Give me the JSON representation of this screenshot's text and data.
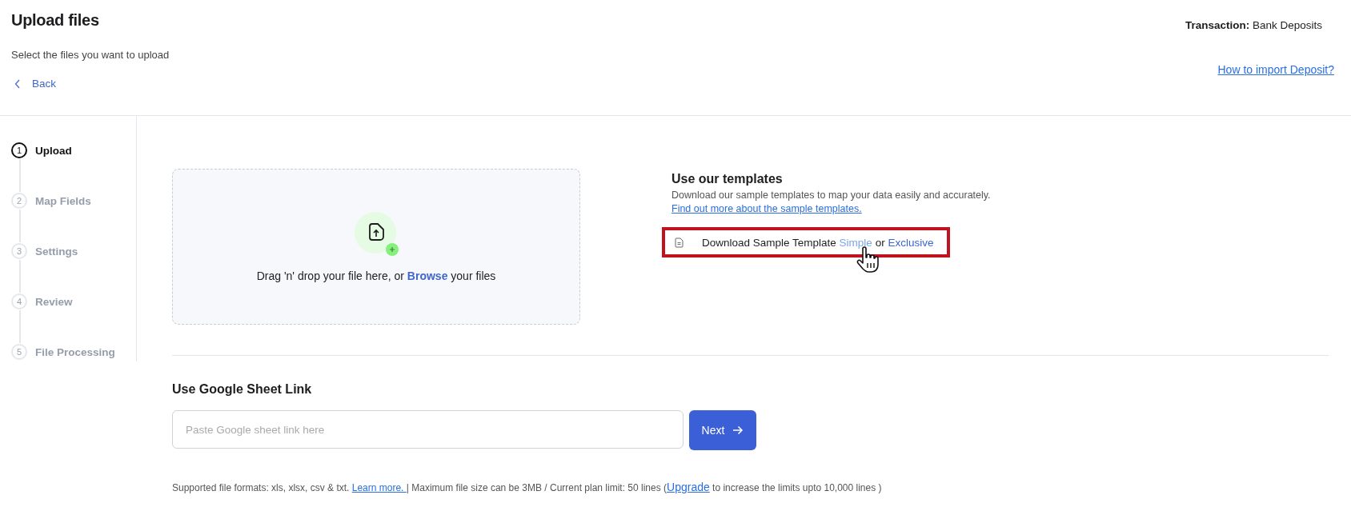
{
  "header": {
    "title": "Upload files",
    "subtitle": "Select the files you want to upload",
    "back": "Back",
    "transaction_label": "Transaction:",
    "transaction_value": "Bank Deposits",
    "help_link": "How to import Deposit?"
  },
  "steps": [
    {
      "number": "1",
      "label": "Upload",
      "selected": true
    },
    {
      "number": "2",
      "label": "Map Fields",
      "selected": false
    },
    {
      "number": "3",
      "label": "Settings",
      "selected": false
    },
    {
      "number": "4",
      "label": "Review",
      "selected": false
    },
    {
      "number": "5",
      "label": "File Processing",
      "selected": false
    }
  ],
  "dropzone": {
    "before": "Drag 'n' drop your file here, or ",
    "link": "Browse",
    "after": " your files"
  },
  "templates": {
    "title": "Use our templates",
    "description": "Download our sample templates to map your data easily and accurately.",
    "more_link": "Find out more about the sample templates.",
    "download_text": "Download Sample Template ",
    "links": [
      {
        "label": "Simple",
        "hovered": true
      },
      {
        "label": "Exclusive",
        "hovered": false
      }
    ],
    "joiner": " or ",
    "highlighted": true
  },
  "google_sheet": {
    "title": "Use Google Sheet Link",
    "placeholder": "Paste Google sheet link here",
    "button": "Next"
  },
  "footer": {
    "formats": "Supported file formats: xls, xlsx, csv & txt. ",
    "learn_more": "Learn more. ",
    "separator": " |  Maximum file size can be 3MB / Current plan limit: 50 lines (",
    "upgrade": "Upgrade",
    "suffix": " to increase the limits upto 10,000 lines )"
  }
}
